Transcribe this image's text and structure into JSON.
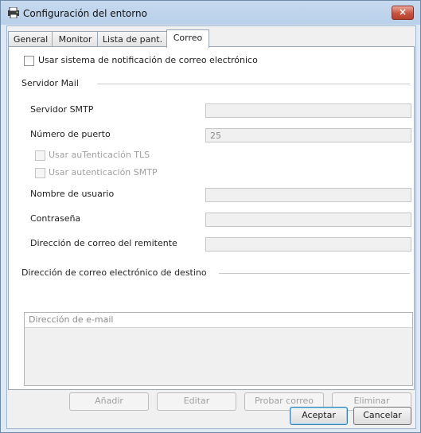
{
  "window": {
    "title": "Configuración del entorno",
    "close_glyph": "×"
  },
  "tabs": [
    "General",
    "Monitor",
    "Lista de pant.",
    "Correo"
  ],
  "active_tab": "Correo",
  "notify": {
    "label": "Usar sistema de notificación de correo electrónico",
    "checked": false
  },
  "mail_server": {
    "section_label": "Servidor Mail",
    "smtp_label": "Servidor SMTP",
    "smtp_value": "",
    "port_label": "Número de puerto",
    "port_value": "25",
    "tls_label": "Usar auTenticación TLS",
    "smtp_auth_label": "Usar autenticación SMTP",
    "user_label": "Nombre de usuario",
    "user_value": "",
    "password_label": "Contraseña",
    "password_value": "",
    "sender_label": "Dirección de correo del remitente",
    "sender_value": ""
  },
  "destination": {
    "section_label": "Dirección de correo electrónico de destino",
    "column_header": "Dirección de e-mail",
    "add_label": "Añadir",
    "edit_label": "Editar",
    "test_label": "Probar correo",
    "delete_label": "Eliminar"
  },
  "footer": {
    "ok_label": "Aceptar",
    "cancel_label": "Cancelar"
  },
  "icons": {
    "app": "printer-settings-icon",
    "close": "close-icon"
  },
  "colors": {
    "close_button": "#c8533f",
    "default_button_border": "#3c7fb1"
  }
}
